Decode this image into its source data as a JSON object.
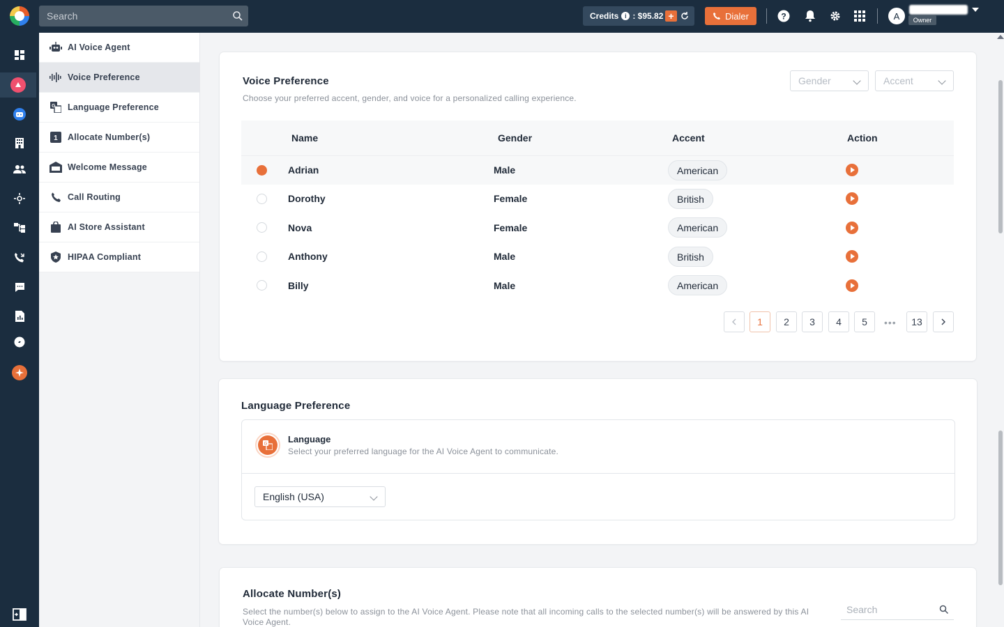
{
  "topbar": {
    "search_placeholder": "Search",
    "credits_label": "Credits",
    "credits_info": "i",
    "credits_amount": ": $95.82",
    "credits_add": "+",
    "dialer_label": "Dialer",
    "avatar_initial": "A",
    "role": "Owner"
  },
  "subnav": {
    "items": [
      {
        "label": "AI Voice Agent",
        "icon": "robot-icon"
      },
      {
        "label": "Voice Preference",
        "icon": "waveform-icon"
      },
      {
        "label": "Language Preference",
        "icon": "translate-icon"
      },
      {
        "label": "Allocate Number(s)",
        "icon": "number-one-icon"
      },
      {
        "label": "Welcome Message",
        "icon": "welcome-icon"
      },
      {
        "label": "Call Routing",
        "icon": "phone-icon"
      },
      {
        "label": "AI Store Assistant",
        "icon": "shopping-bag-icon"
      },
      {
        "label": "HIPAA Compliant",
        "icon": "shield-icon"
      }
    ]
  },
  "voice": {
    "title": "Voice Preference",
    "description": "Choose your preferred accent, gender, and voice for a personalized calling experience.",
    "gender_placeholder": "Gender",
    "accent_placeholder": "Accent",
    "headers": {
      "name": "Name",
      "gender": "Gender",
      "accent": "Accent",
      "action": "Action"
    },
    "rows": [
      {
        "name": "Adrian",
        "gender": "Male",
        "accent": "American"
      },
      {
        "name": "Dorothy",
        "gender": "Female",
        "accent": "British"
      },
      {
        "name": "Nova",
        "gender": "Female",
        "accent": "American"
      },
      {
        "name": "Anthony",
        "gender": "Male",
        "accent": "British"
      },
      {
        "name": "Billy",
        "gender": "Male",
        "accent": "American"
      }
    ],
    "pagination": {
      "pages": [
        "1",
        "2",
        "3",
        "4",
        "5"
      ],
      "dots": "•••",
      "last": "13",
      "current": "1"
    }
  },
  "language": {
    "title": "Language Preference",
    "box_title": "Language",
    "box_desc": "Select your preferred language for the AI Voice Agent to communicate.",
    "selected": "English (USA)"
  },
  "allocate": {
    "title": "Allocate Number(s)",
    "description": "Select the number(s) below to assign to the AI Voice Agent. Please note that all incoming calls to the selected number(s) will be answered by this AI Voice Agent.",
    "search_placeholder": "Search"
  },
  "colors": {
    "accent": "#e8703a",
    "topbar": "#1b2d3f"
  }
}
